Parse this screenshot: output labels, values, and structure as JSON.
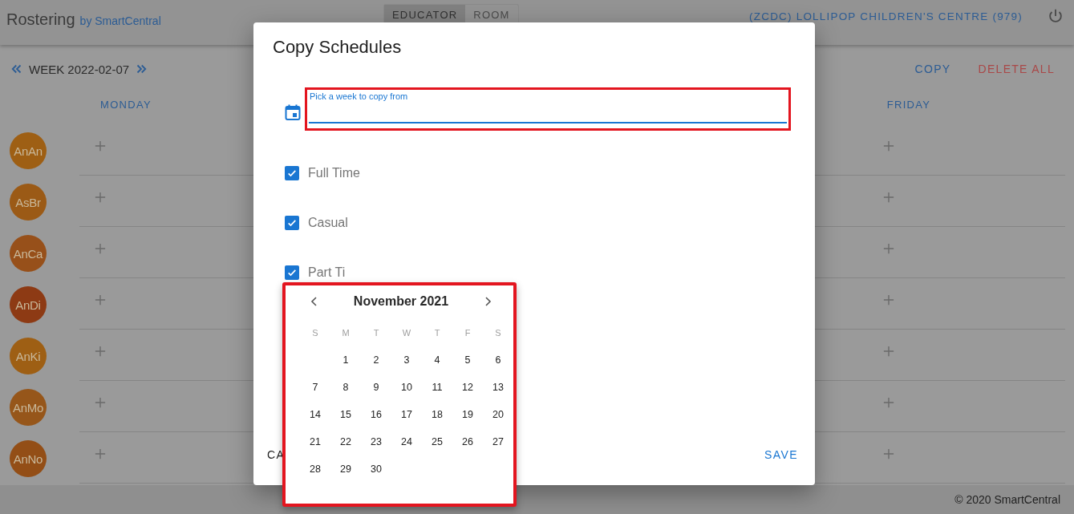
{
  "app_bar": {
    "title": "Rostering",
    "subtitle": "by SmartCentral",
    "view_toggle": [
      {
        "label": "EDUCATOR",
        "selected": true
      },
      {
        "label": "ROOM",
        "selected": false
      }
    ],
    "centre": "(ZCDC) LOLLIPOP CHILDREN'S CENTRE (979)"
  },
  "week_bar": {
    "label": "WEEK 2022-02-07",
    "actions": [
      {
        "label": "COPY",
        "kind": "normal"
      },
      {
        "label": "DELETE ALL",
        "kind": "danger"
      }
    ]
  },
  "day_columns": {
    "first": "MONDAY",
    "last": "FRIDAY"
  },
  "educators": [
    {
      "initials": "AnAn",
      "color": "#9e5f14"
    },
    {
      "initials": "AsBr",
      "color": "#9b5a16"
    },
    {
      "initials": "AnCa",
      "color": "#97501a"
    },
    {
      "initials": "AnDi",
      "color": "#8d3a14"
    },
    {
      "initials": "AnKi",
      "color": "#9e5f14"
    },
    {
      "initials": "AnMo",
      "color": "#96561a"
    },
    {
      "initials": "AnNo",
      "color": "#934e16"
    }
  ],
  "footer": "© 2020 SmartCentral",
  "dialog": {
    "title": "Copy Schedules",
    "week_field": {
      "label": "Pick a week to copy from",
      "focused": true,
      "highlighted": true
    },
    "options": [
      {
        "label": "Full Time",
        "checked": true
      },
      {
        "label": "Casual",
        "checked": true
      },
      {
        "label": "Part Ti",
        "checked": true
      }
    ],
    "cancel": "CA",
    "save": "SAVE"
  },
  "calendar": {
    "month": "November 2021",
    "highlighted": true,
    "weekdays": [
      "S",
      "M",
      "T",
      "W",
      "T",
      "F",
      "S"
    ],
    "weeks": [
      [
        "1",
        "2",
        "3",
        "4",
        "5",
        "6"
      ],
      [
        "7",
        "8",
        "9",
        "10",
        "11",
        "12",
        "13"
      ],
      [
        "14",
        "15",
        "16",
        "17",
        "18",
        "19",
        "20"
      ],
      [
        "21",
        "22",
        "23",
        "24",
        "25",
        "26",
        "27"
      ],
      [
        "28",
        "29",
        "30"
      ]
    ]
  }
}
